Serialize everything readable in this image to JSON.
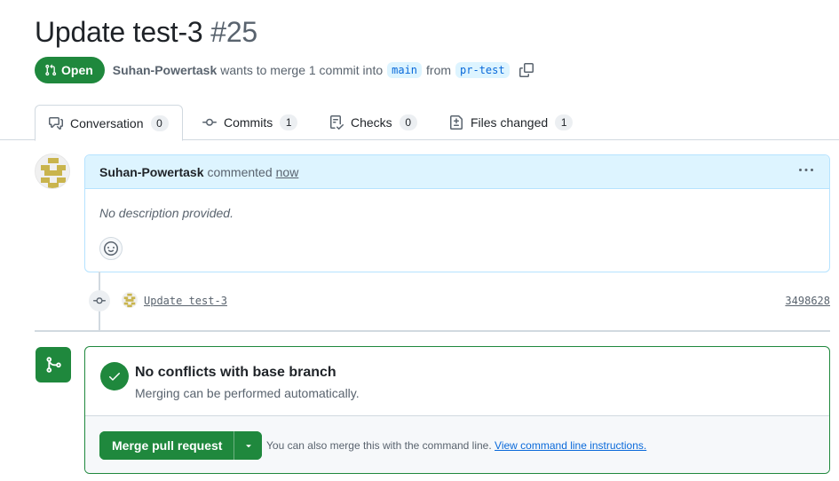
{
  "pr": {
    "title": "Update test-3",
    "number": "#25",
    "state": "Open",
    "author": "Suhan-Powertask",
    "summary_text": "wants to merge 1 commit into",
    "base_branch": "main",
    "from_text": "from",
    "head_branch": "pr-test"
  },
  "tabs": [
    {
      "label": "Conversation",
      "count": "0",
      "icon": "comment-discussion-icon"
    },
    {
      "label": "Commits",
      "count": "1",
      "icon": "git-commit-icon"
    },
    {
      "label": "Checks",
      "count": "0",
      "icon": "checklist-icon"
    },
    {
      "label": "Files changed",
      "count": "1",
      "icon": "file-diff-icon"
    }
  ],
  "comment": {
    "author": "Suhan-Powertask",
    "action": "commented",
    "time": "now",
    "body": "No description provided."
  },
  "commit": {
    "message": "Update test-3",
    "sha": "3498628"
  },
  "merge": {
    "title": "No conflicts with base branch",
    "subtitle": "Merging can be performed automatically.",
    "button_label": "Merge pull request",
    "hint_text": "You can also merge this with the command line.",
    "hint_link": "View command line instructions."
  },
  "colors": {
    "success": "#1f883d",
    "link": "#0969da",
    "comment_header": "#ddf4ff"
  }
}
